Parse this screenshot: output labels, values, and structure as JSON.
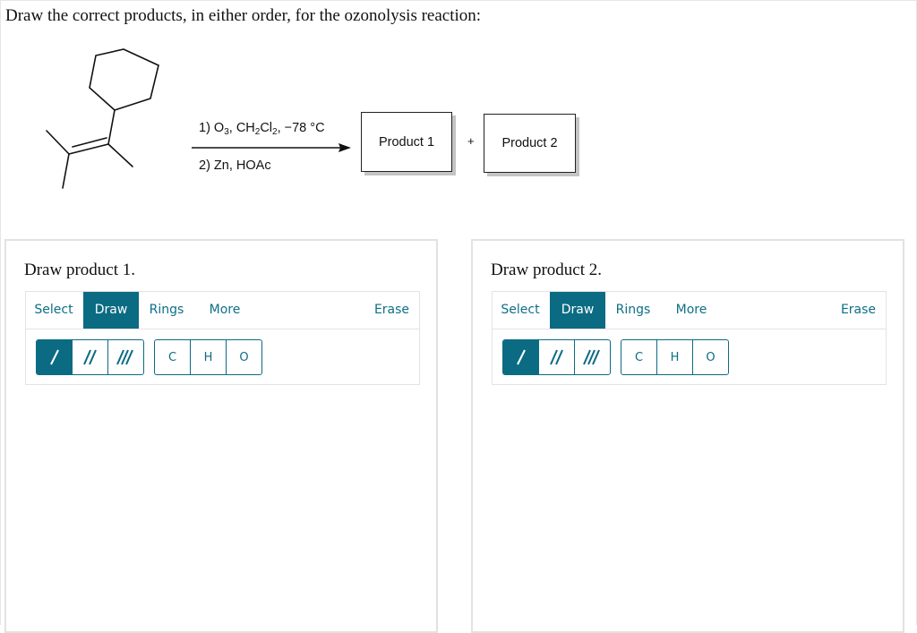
{
  "question": "Draw the correct products, in either order, for the ozonolysis reaction:",
  "reaction": {
    "condition1": {
      "prefix": "1) O",
      "sub1": "3",
      "mid": ", CH",
      "sub2": "2",
      "mid2": "Cl",
      "sub3": "2",
      "suffix": ", −78 °C"
    },
    "condition2": "2) Zn, HOAc",
    "plus": "+",
    "product1_label": "Product 1",
    "product2_label": "Product 2"
  },
  "panels": [
    {
      "title": "Draw product 1.",
      "tabs": {
        "select": "Select",
        "draw": "Draw",
        "rings": "Rings",
        "more": "More",
        "erase": "Erase"
      },
      "active_tab": "Draw",
      "bond_tools": [
        "single-bond-icon",
        "double-bond-icon",
        "triple-bond-icon"
      ],
      "atoms": [
        "C",
        "H",
        "O"
      ]
    },
    {
      "title": "Draw product 2.",
      "tabs": {
        "select": "Select",
        "draw": "Draw",
        "rings": "Rings",
        "more": "More",
        "erase": "Erase"
      },
      "active_tab": "Draw",
      "bond_tools": [
        "single-bond-icon",
        "double-bond-icon",
        "triple-bond-icon"
      ],
      "atoms": [
        "C",
        "H",
        "O"
      ]
    }
  ],
  "colors": {
    "accent": "#0b6b83",
    "text": "#111111",
    "border": "#e2e2e2"
  }
}
